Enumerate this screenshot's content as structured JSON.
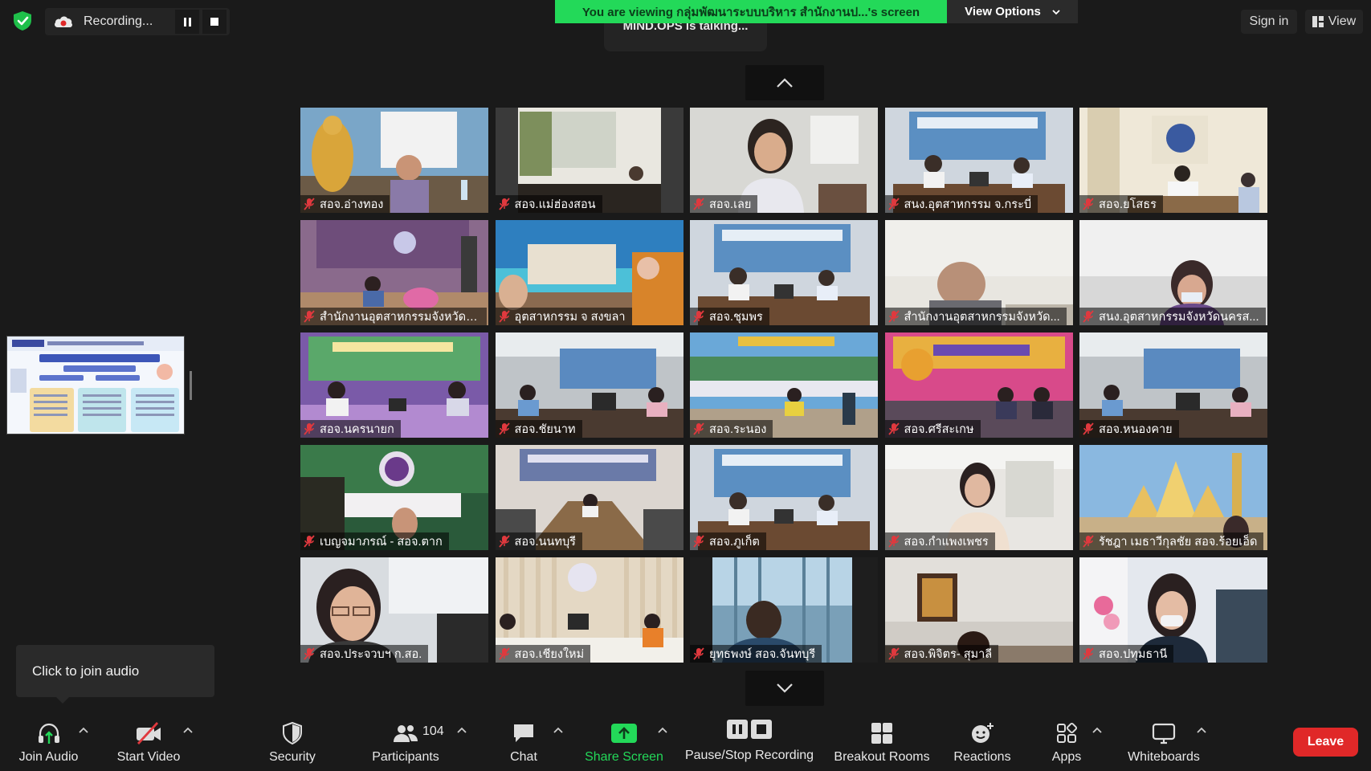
{
  "top_bar": {
    "recording_label": "Recording...",
    "viewing_banner": "You are viewing กลุ่มพัฒนาระบบบริหาร สำนักงานป...'s screen",
    "view_options_label": "View Options",
    "talking_label": "MIND.OPS is talking...",
    "sign_in_label": "Sign in",
    "view_label": "View"
  },
  "participants_grid": [
    {
      "name": "สอจ.อ่างทอง",
      "scene": "buddha"
    },
    {
      "name": "สอจ.แม่ฮ่องสอน",
      "scene": "room-curtain"
    },
    {
      "name": "สอจ.เลย",
      "scene": "woman-office"
    },
    {
      "name": "สนง.อุตสาหกรรม จ.กระบี่",
      "scene": "meeting-blue"
    },
    {
      "name": "สอจ.ยโสธร",
      "scene": "office-beige"
    },
    {
      "name": "สำนักงานอุตสาหกรรมจังหวัดสุ...",
      "scene": "purple-backdrop"
    },
    {
      "name": "อุตสาหกรรม จ สงขลา",
      "scene": "beach-backdrop"
    },
    {
      "name": "สอจ.ชุมพร",
      "scene": "meeting-blue"
    },
    {
      "name": "สำนักงานอุตสาหกรรมจังหวัด...",
      "scene": "blurry-man"
    },
    {
      "name": "สนง.อุตสาหกรรมจังหวัดนครส...",
      "scene": "blurry-woman"
    },
    {
      "name": "สอจ.นครนายก",
      "scene": "purple-meeting"
    },
    {
      "name": "สอจ.ชัยนาท",
      "scene": "office-grey"
    },
    {
      "name": "สอจ.ระนอง",
      "scene": "landscape-backdrop"
    },
    {
      "name": "สอจ.ศรีสะเกษ",
      "scene": "colorful-backdrop"
    },
    {
      "name": "สอจ.หนองคาย",
      "scene": "office-grey"
    },
    {
      "name": "เบญจมาภรณ์ - สอจ.ตาก",
      "scene": "green-logo"
    },
    {
      "name": "สอจ.นนทบุรี",
      "scene": "meeting-table"
    },
    {
      "name": "สอจ.ภูเก็ต",
      "scene": "meeting-blue"
    },
    {
      "name": "สอจ.กำแพงเพชร",
      "scene": "woman-white"
    },
    {
      "name": "รัชฎา เมธาวีกุลชัย สอจ.ร้อยเอ็ด",
      "scene": "temple"
    },
    {
      "name": "สอจ.ประจวบฯ ก.สอ.",
      "scene": "woman-glasses"
    },
    {
      "name": "สอจ.เชียงใหม่",
      "scene": "wood-wall"
    },
    {
      "name": "ยุทธพงษ์ สอจ.จันทบุรี",
      "scene": "man-window"
    },
    {
      "name": "สอจ.พิจิตร- สุมาลี",
      "scene": "dark-room"
    },
    {
      "name": "สอจ.ปทุมธานี",
      "scene": "woman-mask"
    }
  ],
  "tooltip": {
    "text": "Click to join audio"
  },
  "toolbar": {
    "join_audio": "Join Audio",
    "start_video": "Start Video",
    "security": "Security",
    "participants": "Participants",
    "participants_count": "104",
    "chat": "Chat",
    "share_screen": "Share Screen",
    "pause_stop_recording": "Pause/Stop Recording",
    "breakout_rooms": "Breakout Rooms",
    "reactions": "Reactions",
    "apps": "Apps",
    "whiteboards": "Whiteboards",
    "leave": "Leave"
  },
  "colors": {
    "share_green": "#23d959",
    "leave_red": "#e02828",
    "muted_red": "#e0393e",
    "security_green": "#1fbf4a"
  }
}
